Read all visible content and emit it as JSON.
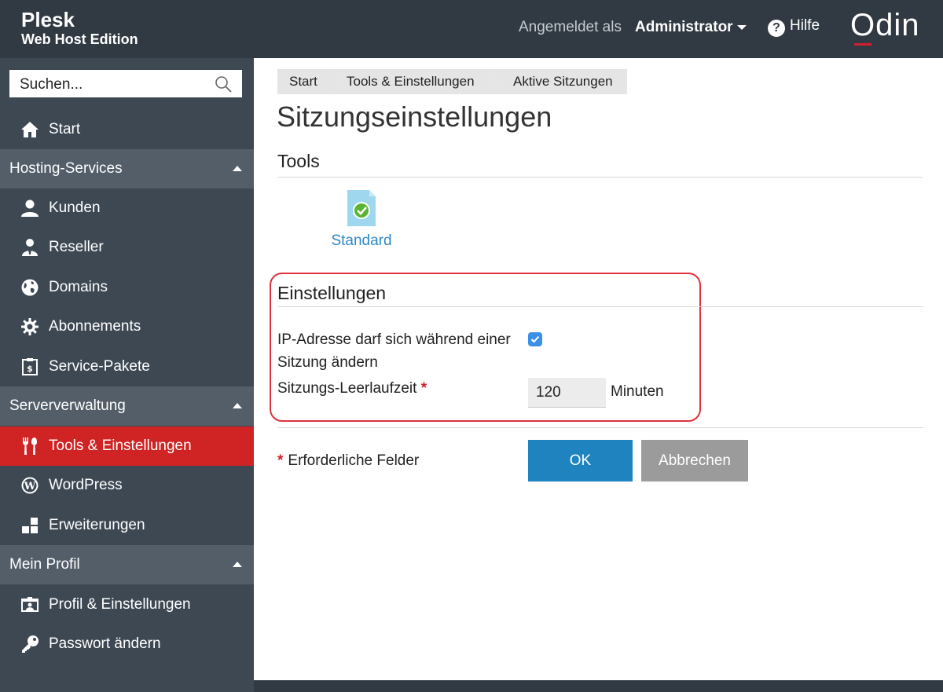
{
  "header": {
    "brand_line1": "Plesk",
    "brand_line2": "Web Host Edition",
    "logged_in_label": "Angemeldet als",
    "user": "Administrator",
    "help_label": "Hilfe",
    "help_icon": "question-circle-icon",
    "logo_text": "Odin",
    "colors": {
      "header_bg": "#313a43",
      "logo_accent": "#d11f2d"
    }
  },
  "sidebar": {
    "search_placeholder": "Suchen...",
    "search_icon": "search-icon",
    "top_items": [
      {
        "label": "Start",
        "icon": "home-icon"
      }
    ],
    "sections": [
      {
        "label": "Hosting-Services",
        "items": [
          {
            "label": "Kunden",
            "icon": "user-icon"
          },
          {
            "label": "Reseller",
            "icon": "reseller-icon"
          },
          {
            "label": "Domains",
            "icon": "globe-icon"
          },
          {
            "label": "Abonnements",
            "icon": "gear-icon"
          },
          {
            "label": "Service-Pakete",
            "icon": "package-icon"
          }
        ]
      },
      {
        "label": "Serververwaltung",
        "items": [
          {
            "label": "Tools & Einstellungen",
            "icon": "tools-icon",
            "active": true
          },
          {
            "label": "WordPress",
            "icon": "wordpress-icon"
          },
          {
            "label": "Erweiterungen",
            "icon": "extensions-icon"
          }
        ]
      },
      {
        "label": "Mein Profil",
        "items": [
          {
            "label": "Profil & Einstellungen",
            "icon": "profile-icon"
          },
          {
            "label": "Passwort ändern",
            "icon": "key-icon"
          }
        ]
      }
    ],
    "colors": {
      "sidebar_bg": "#3d4853",
      "section_bg": "#535e69",
      "active_bg": "#d02323"
    }
  },
  "breadcrumb": [
    "Start",
    "Tools & Einstellungen",
    "Aktive Sitzungen"
  ],
  "page_title": "Sitzungseinstellungen",
  "tools": {
    "heading": "Tools",
    "items": [
      {
        "label": "Standard",
        "icon": "document-check-icon"
      }
    ]
  },
  "settings": {
    "heading": "Einstellungen",
    "ip_change_label": "IP-Adresse darf sich während einer Sitzung ändern",
    "ip_change_checked": true,
    "idle_label": "Sitzungs-Leerlaufzeit",
    "required_marker": "*",
    "idle_value": "120",
    "idle_unit": "Minuten"
  },
  "form": {
    "required_note": "Erforderliche Felder",
    "required_marker": "*",
    "ok_label": "OK",
    "cancel_label": "Abbrechen",
    "colors": {
      "ok_bg": "#1e83be",
      "cancel_bg": "#9b9b9b"
    }
  }
}
